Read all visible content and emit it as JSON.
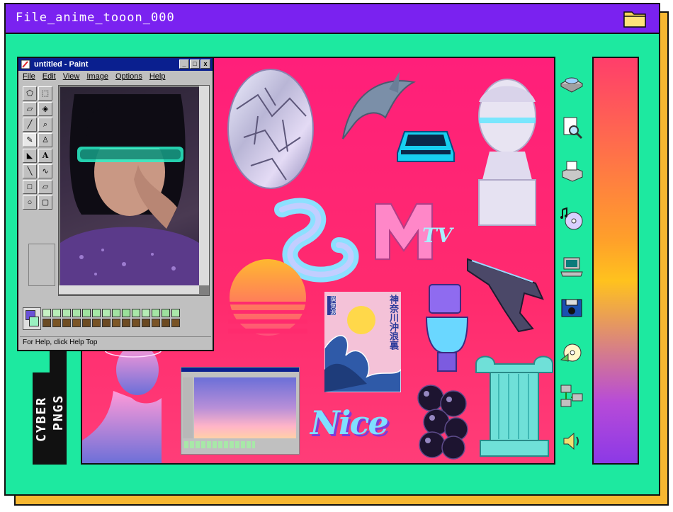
{
  "window": {
    "title": "File_anime_tooon_000",
    "titlebar_color": "#7a22f0",
    "body_color": "#1de9a0",
    "shadow_color": "#f7b731",
    "folder_icon": "folder-icon"
  },
  "paint": {
    "title": "untitled - Paint",
    "menu": [
      "File",
      "Edit",
      "View",
      "Image",
      "Options",
      "Help"
    ],
    "window_buttons": [
      "_",
      "□",
      "x"
    ],
    "status": "For Help, click Help Top",
    "tools": [
      "free-select-icon",
      "rect-select-icon",
      "eraser-icon",
      "fill-icon",
      "color-picker-icon",
      "magnifier-icon",
      "pencil-icon",
      "brush-icon",
      "airbrush-icon",
      "text-icon",
      "line-icon",
      "curve-icon",
      "rectangle-icon",
      "polygon-icon",
      "ellipse-icon",
      "rounded-rect-icon"
    ],
    "palette_top": [
      "#c7f2c4",
      "#b8efb8",
      "#b0e8b0",
      "#a8e6a8",
      "#9fe39f",
      "#a6e9a6",
      "#b2ecb2",
      "#a2e3a2",
      "#9ae09a",
      "#a9e8a9",
      "#b6edb6",
      "#a4e5a4",
      "#9ddf9d",
      "#aae8aa"
    ],
    "palette_bottom": [
      "#6a4a22",
      "#7a5525",
      "#6f4d22",
      "#7b5526",
      "#6c4b21",
      "#775325",
      "#6b4922",
      "#7e5827",
      "#6e4c23",
      "#745024",
      "#6a4922",
      "#7a5426",
      "#6d4b22",
      "#785325"
    ]
  },
  "collage": {
    "background": "#ff1f7a",
    "items": [
      "chrome-head",
      "dolphin",
      "delorean-car",
      "greek-bust",
      "twisted-ribbon",
      "mtv-logo",
      "retro-sun",
      "wave-poster",
      "pistol",
      "toilet",
      "greek-statue",
      "mini-paint-screenshot",
      "nice-lettering",
      "chrome-spheres",
      "column"
    ],
    "mtv_text": "TV",
    "poster_text": "神奈川沖浪裏",
    "poster_small": "蒸気波",
    "nice_text": "Nice"
  },
  "cyber_label": {
    "line1": "CYBER",
    "line2": "PNGS"
  },
  "side_icons": [
    "cd-drive-icon",
    "document-search-icon",
    "printer-icon",
    "music-cd-icon",
    "computer-icon",
    "camera-disk-icon",
    "cd-audio-icon",
    "network-icon",
    "speaker-icon"
  ],
  "gradient_bar": {
    "colors": [
      "#ff3e6b",
      "#ffa02a",
      "#ffc21e",
      "#b74bd8",
      "#8c39e6"
    ]
  }
}
